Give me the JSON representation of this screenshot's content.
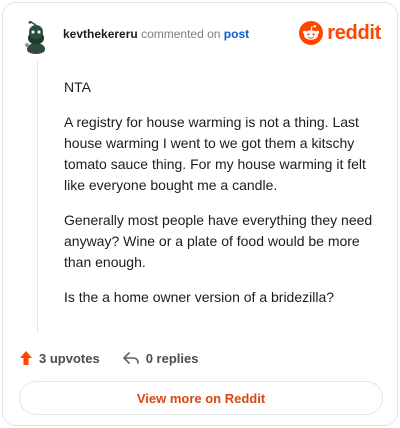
{
  "header": {
    "username": "kevthekereru",
    "action_text": "commented on",
    "post_link": "post",
    "brand_name": "reddit",
    "brand_color": "#ff4500"
  },
  "comment": {
    "paragraphs": [
      "NTA",
      "A registry for house warming is not a thing. Last house warming I went to we got them a kitschy tomato sauce thing. For my house warming it felt like everyone bought me a candle.",
      "Generally most people have everything they need anyway? Wine or a plate of food would be more than enough.",
      "Is the a home owner version of a bridezilla?"
    ]
  },
  "actions": {
    "upvotes": "3 upvotes",
    "replies": "0 replies"
  },
  "footer": {
    "view_more": "View more on Reddit"
  },
  "icons": {
    "avatar": "snoo-avatar-icon",
    "brand": "reddit-snoo-logo-icon",
    "upvote": "upvote-arrow-icon",
    "reply": "reply-arrow-icon"
  }
}
